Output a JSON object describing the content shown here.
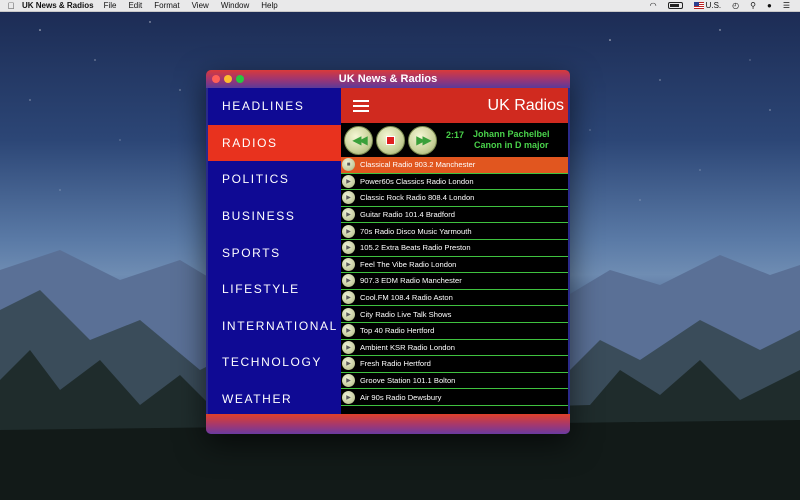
{
  "menubar": {
    "app_name": "UK News & Radios",
    "items": [
      "File",
      "Edit",
      "Format",
      "View",
      "Window",
      "Help"
    ],
    "status": {
      "input_source": "U.S."
    }
  },
  "window": {
    "title": "UK News & Radios"
  },
  "sidebar": {
    "items": [
      {
        "label": "HEADLINES",
        "active": false
      },
      {
        "label": "RADIOS",
        "active": true
      },
      {
        "label": "POLITICS",
        "active": false
      },
      {
        "label": "BUSINESS",
        "active": false
      },
      {
        "label": "SPORTS",
        "active": false
      },
      {
        "label": "LIFESTYLE",
        "active": false
      },
      {
        "label": "INTERNATIONAL",
        "active": false
      },
      {
        "label": "TECHNOLOGY",
        "active": false
      },
      {
        "label": "WEATHER",
        "active": false
      }
    ]
  },
  "header": {
    "title": "UK Radios"
  },
  "player": {
    "time": "2:17",
    "artist": "Johann Pachelbel",
    "track": "Canon in D major"
  },
  "stations": [
    {
      "name": "Classical Radio 903.2 Manchester",
      "playing": true
    },
    {
      "name": "Power60s Classics Radio London",
      "playing": false
    },
    {
      "name": "Classic Rock Radio 808.4 London",
      "playing": false
    },
    {
      "name": "Guitar Radio 101.4 Bradford",
      "playing": false
    },
    {
      "name": "70s Radio Disco Music Yarmouth",
      "playing": false
    },
    {
      "name": "105.2 Extra Beats Radio Preston",
      "playing": false
    },
    {
      "name": "Feel The Vibe Radio London",
      "playing": false
    },
    {
      "name": "907.3 EDM Radio Manchester",
      "playing": false
    },
    {
      "name": "Cool.FM 108.4 Radio Aston",
      "playing": false
    },
    {
      "name": "City Radio Live Talk Shows",
      "playing": false
    },
    {
      "name": "Top 40 Radio Hertford",
      "playing": false
    },
    {
      "name": "Ambient KSR Radio London",
      "playing": false
    },
    {
      "name": "Fresh Radio Hertford",
      "playing": false
    },
    {
      "name": "Groove Station 101.1 Bolton",
      "playing": false
    },
    {
      "name": "Air 90s Radio Dewsbury",
      "playing": false
    }
  ],
  "colors": {
    "sidebar_bg": "#0f0a94",
    "active_nav": "#e8321e",
    "header_red": "#d02a1f",
    "playing_row": "#e1561f",
    "divider_green": "#3fc13f",
    "player_text": "#49d14a"
  }
}
